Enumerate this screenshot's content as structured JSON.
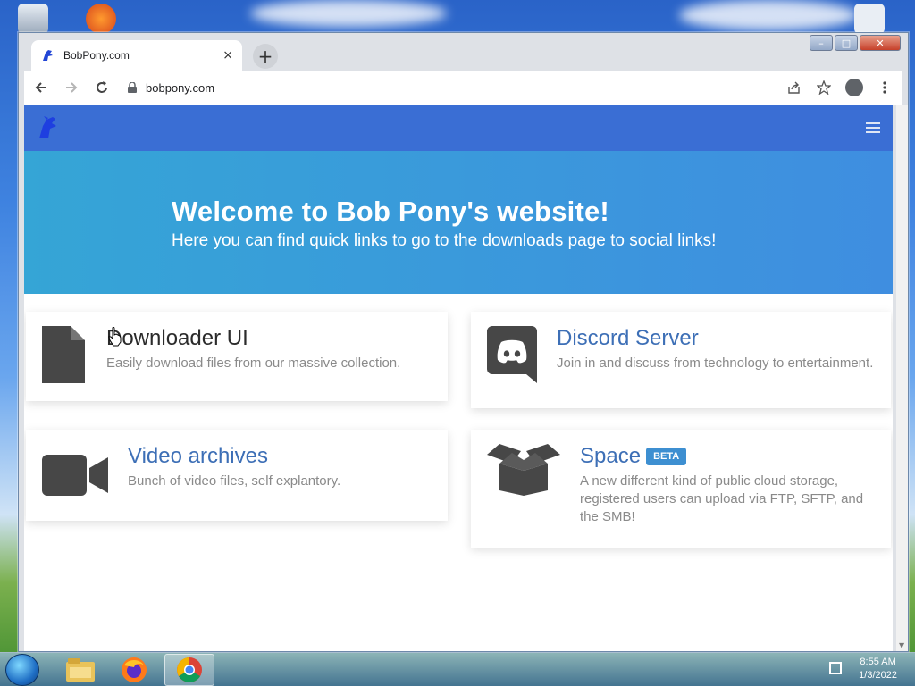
{
  "browser": {
    "tab_title": "BobPony.com",
    "tab_close": "×",
    "new_tab": "+",
    "url": "bobpony.com",
    "window_buttons": {
      "minimize": "–",
      "maximize": "□",
      "close": "✕"
    }
  },
  "site": {
    "hero_title": "Welcome to Bob Pony's website!",
    "hero_subtitle": "Here you can find quick links to go to the downloads page to social links!"
  },
  "cards": [
    {
      "title": "Downloader UI",
      "desc": "Easily download files from our massive collection.",
      "icon": "file-icon"
    },
    {
      "title": "Discord Server",
      "desc": "Join in and discuss from technology to entertainment.",
      "icon": "discord-icon"
    },
    {
      "title": "Video archives",
      "desc": "Bunch of video files, self explantory.",
      "icon": "video-camera-icon"
    },
    {
      "title": "Space",
      "badge": "BETA",
      "desc": "A new different kind of public cloud storage, registered users can upload via FTP, SFTP, and the SMB!",
      "icon": "open-box-icon"
    }
  ],
  "taskbar": {
    "time": "8:55 AM",
    "date": "1/3/2022",
    "apps": [
      "file-explorer-icon",
      "firefox-icon",
      "chrome-icon"
    ]
  },
  "colors": {
    "site_nav": "#3a6ed4",
    "hero_from": "#35a5d6",
    "hero_to": "#3f8ee0",
    "card_title": "#3d6fb6",
    "badge": "#3d8fd1"
  }
}
